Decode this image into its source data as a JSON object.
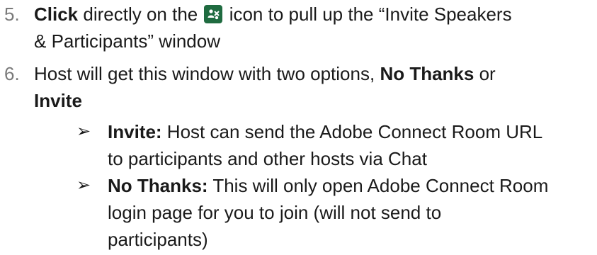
{
  "steps": [
    {
      "number": "5.",
      "bold_lead": "Click",
      "text_before_icon": " directly on the ",
      "icon": "invite-participants-icon",
      "text_after_icon": " icon to pull up the “Invite Speakers",
      "continuation": "& Participants” window"
    },
    {
      "number": "6.",
      "line1_text": "Host will get this window with two options, ",
      "line1_bold": "No Thanks",
      "line1_tail": " or",
      "line2_bold": "Invite"
    }
  ],
  "bullets": [
    {
      "marker": "➢",
      "label": "Invite:",
      "line1": " Host can send the Adobe Connect Room URL",
      "line2": "to participants and other hosts via Chat"
    },
    {
      "marker": "➢",
      "label": "No Thanks:",
      "line1": " This will only open Adobe Connect Room",
      "line2": "login page for you to join (will not send to",
      "line3": "participants)"
    }
  ],
  "colors": {
    "icon_bg": "#1f6b40",
    "number_color": "#7a7a7a"
  }
}
